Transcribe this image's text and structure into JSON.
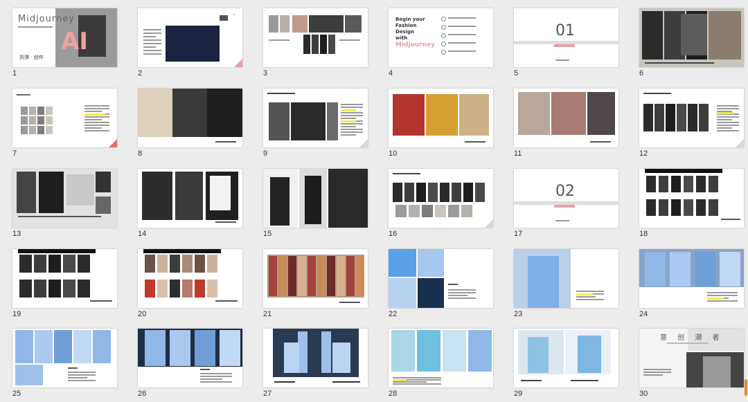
{
  "slides": [
    {
      "number": "1",
      "title": "Midjourney",
      "big": "AI",
      "caption": "刘淇 · 创作"
    },
    {
      "number": "2"
    },
    {
      "number": "3"
    },
    {
      "number": "4",
      "lines": [
        "Begin your",
        "Fashion",
        "Design",
        "with"
      ],
      "accent": "Midjourney"
    },
    {
      "number": "5",
      "big": "01"
    },
    {
      "number": "6"
    },
    {
      "number": "7"
    },
    {
      "number": "8"
    },
    {
      "number": "9"
    },
    {
      "number": "10"
    },
    {
      "number": "11"
    },
    {
      "number": "12"
    },
    {
      "number": "13"
    },
    {
      "number": "14"
    },
    {
      "number": "15"
    },
    {
      "number": "16"
    },
    {
      "number": "17",
      "big": "02"
    },
    {
      "number": "18"
    },
    {
      "number": "19"
    },
    {
      "number": "20"
    },
    {
      "number": "21"
    },
    {
      "number": "22"
    },
    {
      "number": "23"
    },
    {
      "number": "24"
    },
    {
      "number": "25"
    },
    {
      "number": "26"
    },
    {
      "number": "27"
    },
    {
      "number": "28"
    },
    {
      "number": "29"
    },
    {
      "number": "30",
      "big": "意 创 潮 者"
    }
  ],
  "colors": {
    "accent_pink": "#e8a0a8",
    "dark": "#222222",
    "blue": "#8fb8e8",
    "highlight": "#f5e84a"
  }
}
